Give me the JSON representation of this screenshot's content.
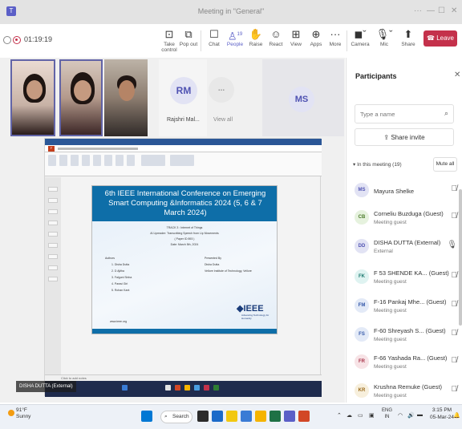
{
  "window": {
    "title": "Meeting in \"General\""
  },
  "toolbar": {
    "timer": "01:19:19",
    "items": [
      {
        "label": "Take control",
        "icon": "hand-icon"
      },
      {
        "label": "Pop out",
        "icon": "popout-icon"
      },
      {
        "label": "Chat",
        "icon": "chat-icon"
      },
      {
        "label": "People",
        "icon": "people-icon",
        "count": "19"
      },
      {
        "label": "Raise",
        "icon": "raise-hand-icon"
      },
      {
        "label": "React",
        "icon": "react-icon"
      },
      {
        "label": "View",
        "icon": "view-icon"
      },
      {
        "label": "Apps",
        "icon": "apps-icon"
      },
      {
        "label": "More",
        "icon": "more-icon"
      },
      {
        "label": "Camera",
        "icon": "camera-icon"
      },
      {
        "label": "Mic",
        "icon": "mic-icon"
      },
      {
        "label": "Share",
        "icon": "share-icon"
      }
    ],
    "leave_label": "Leave"
  },
  "gallery": {
    "rm_initials": "RM",
    "rm_name": "Rajshri Mal...",
    "view_all_dots": "...",
    "view_all_label": "View all",
    "ms_initials": "MS"
  },
  "presenter_label": "DISHA DUTTA (External)",
  "shared_slide": {
    "title": "6th IEEE International Conference on Emerging Smart Computing &Informatics 2024 (5, 6 & 7 March 2024)",
    "track": "TRACK 3 : Internet of Things",
    "paper": "AI Lipreader: Transcribing Speech from Lip Movements",
    "paper_id": "( Paper ID 893 )",
    "date": "Date: March 5th, 2024",
    "authors_heading": "Authors",
    "authors": [
      "1.     Disha Dutta",
      "2.     D Ajitha",
      "3.     Falguni Sinha",
      "4.     Parasi Giri",
      "5.     Rohan Kant"
    ],
    "presenter_heading": "Presented By",
    "presenter_name": "Disha Dutta",
    "presenter_org": "Vellore Institute of Technology, Vellore",
    "ieee": "IEEE",
    "ieee_tagline": "Advancing Technology for Humanity",
    "website": "www.ieee.org",
    "notes": "Click to add notes"
  },
  "participants": {
    "heading": "Participants",
    "search_placeholder": "Type a name",
    "share_invite": "Share invite",
    "in_meeting": "In this meeting (19)",
    "mute_all": "Mute all",
    "list": [
      {
        "initials": "MS",
        "name": "Mayura Shelke",
        "sub": "",
        "color": "#e2e3f4",
        "text": "#4f52b2"
      },
      {
        "initials": "CB",
        "name": "Corneliu Buzduga (Guest)",
        "sub": "Meeting guest",
        "color": "#e6f2de",
        "text": "#4a7a2a"
      },
      {
        "initials": "DD",
        "name": "DISHA DUTTA (External)",
        "sub": "External",
        "color": "#e2e3f4",
        "text": "#4f52b2"
      },
      {
        "initials": "FK",
        "name": "F 53 SHENDE KA...  (Guest)",
        "sub": "Meeting guest",
        "color": "#dff3f1",
        "text": "#1e7a70"
      },
      {
        "initials": "FM",
        "name": "F-16 Pankaj Mhe...  (Guest)",
        "sub": "Meeting guest",
        "color": "#e3eaf7",
        "text": "#3458a8"
      },
      {
        "initials": "FS",
        "name": "F-60 Shreyash S...  (Guest)",
        "sub": "Meeting guest",
        "color": "#e3eaf7",
        "text": "#3458a8"
      },
      {
        "initials": "FR",
        "name": "F-66 Yashada Ra...  (Guest)",
        "sub": "Meeting guest",
        "color": "#f7e3e6",
        "text": "#a8344a"
      },
      {
        "initials": "KR",
        "name": "Krushna Remuke (Guest)",
        "sub": "Meeting guest",
        "color": "#f7efdc",
        "text": "#9a6a1a"
      }
    ]
  },
  "taskbar": {
    "weather_temp": "91°F",
    "weather_desc": "Sunny",
    "search_label": "Search",
    "lang_top": "ENG",
    "lang_bottom": "IN",
    "time": "3:15 PM",
    "date": "05-Mar-24"
  }
}
